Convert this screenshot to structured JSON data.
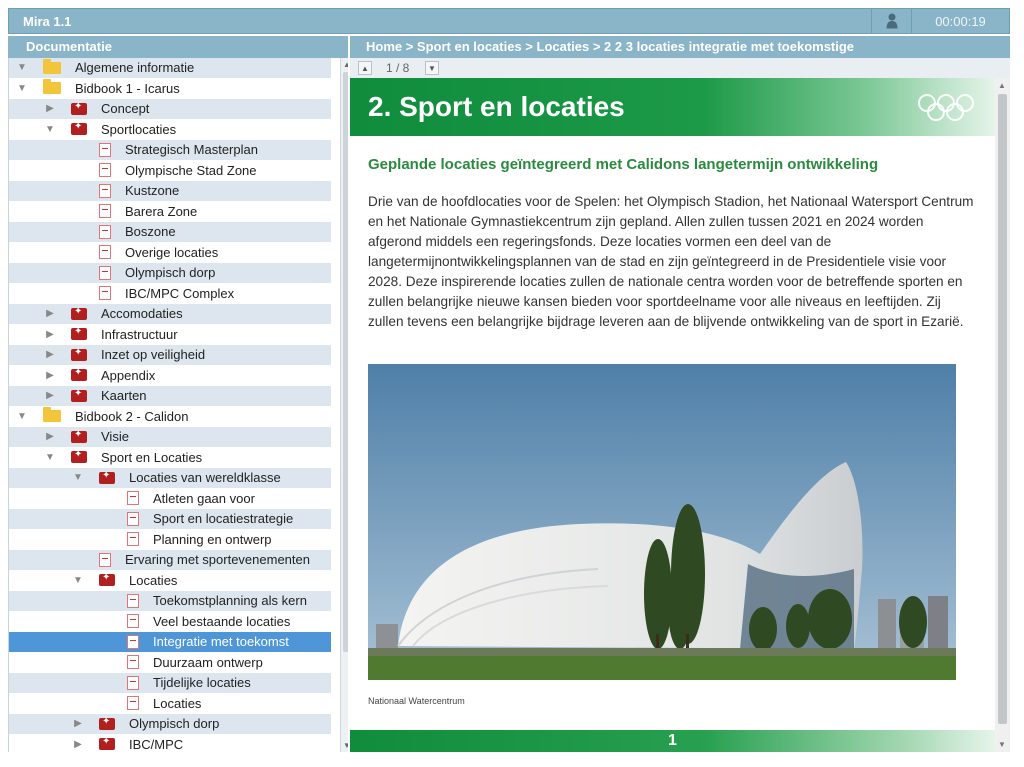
{
  "app": {
    "title": "Mira 1.1",
    "timer": "00:00:19",
    "user_icon": "user-icon"
  },
  "sidebar": {
    "header": "Documentatie",
    "items": [
      {
        "label": "Algemene informatie",
        "level": 0,
        "icon": "folder",
        "expanded": true,
        "shade": true
      },
      {
        "label": "Bidbook 1 - Icarus",
        "level": 0,
        "icon": "folder",
        "expanded": true,
        "shade": false
      },
      {
        "label": "Concept",
        "level": 1,
        "icon": "pdf",
        "expanded": false,
        "shade": true
      },
      {
        "label": "Sportlocaties",
        "level": 1,
        "icon": "pdf",
        "expanded": true,
        "shade": false
      },
      {
        "label": "Strategisch Masterplan",
        "level": 2,
        "icon": "page",
        "shade": true
      },
      {
        "label": "Olympische Stad Zone",
        "level": 2,
        "icon": "page",
        "shade": false
      },
      {
        "label": "Kustzone",
        "level": 2,
        "icon": "page",
        "shade": true
      },
      {
        "label": "Barera Zone",
        "level": 2,
        "icon": "page",
        "shade": false
      },
      {
        "label": "Boszone",
        "level": 2,
        "icon": "page",
        "shade": true
      },
      {
        "label": "Overige locaties",
        "level": 2,
        "icon": "page",
        "shade": false
      },
      {
        "label": "Olympisch dorp",
        "level": 2,
        "icon": "page",
        "shade": true
      },
      {
        "label": "IBC/MPC Complex",
        "level": 2,
        "icon": "page",
        "shade": false
      },
      {
        "label": "Accomodaties",
        "level": 1,
        "icon": "pdf",
        "expanded": false,
        "shade": true
      },
      {
        "label": "Infrastructuur",
        "level": 1,
        "icon": "pdf",
        "expanded": false,
        "shade": false
      },
      {
        "label": "Inzet op veiligheid",
        "level": 1,
        "icon": "pdf",
        "expanded": false,
        "shade": true
      },
      {
        "label": "Appendix",
        "level": 1,
        "icon": "pdf",
        "expanded": false,
        "shade": false
      },
      {
        "label": "Kaarten",
        "level": 1,
        "icon": "pdf",
        "expanded": false,
        "shade": true
      },
      {
        "label": "Bidbook 2 - Calidon",
        "level": 0,
        "icon": "folder",
        "expanded": true,
        "shade": false
      },
      {
        "label": "Visie",
        "level": 1,
        "icon": "pdf",
        "expanded": false,
        "shade": true
      },
      {
        "label": "Sport en Locaties",
        "level": 1,
        "icon": "pdf",
        "expanded": true,
        "shade": false
      },
      {
        "label": "Locaties van wereldklasse",
        "level": 2,
        "icon": "pdf",
        "expanded": true,
        "shade": true
      },
      {
        "label": "Atleten gaan voor",
        "level": 3,
        "icon": "page",
        "shade": false
      },
      {
        "label": "Sport en locatiestrategie",
        "level": 3,
        "icon": "page",
        "shade": true
      },
      {
        "label": "Planning en ontwerp",
        "level": 3,
        "icon": "page",
        "shade": false
      },
      {
        "label": "Ervaring met sportevenementen",
        "level": 2,
        "icon": "page",
        "shade": true
      },
      {
        "label": "Locaties",
        "level": 2,
        "icon": "pdf",
        "expanded": true,
        "shade": false
      },
      {
        "label": "Toekomstplanning als kern",
        "level": 3,
        "icon": "page",
        "shade": true
      },
      {
        "label": "Veel bestaande locaties",
        "level": 3,
        "icon": "page",
        "shade": false
      },
      {
        "label": "Integratie met toekomst",
        "level": 3,
        "icon": "page",
        "shade": false,
        "selected": true
      },
      {
        "label": "Duurzaam ontwerp",
        "level": 3,
        "icon": "page",
        "shade": false
      },
      {
        "label": "Tijdelijke locaties",
        "level": 3,
        "icon": "page",
        "shade": true
      },
      {
        "label": "Locaties",
        "level": 3,
        "icon": "page",
        "shade": false
      },
      {
        "label": "Olympisch dorp",
        "level": 2,
        "icon": "pdf",
        "expanded": false,
        "shade": true
      },
      {
        "label": "IBC/MPC",
        "level": 2,
        "icon": "pdf",
        "expanded": false,
        "shade": false
      }
    ]
  },
  "breadcrumb": "Home > Sport en locaties > Locaties > 2 2 3 locaties integratie met toekomstige",
  "pager": {
    "indicator": "1 / 8",
    "prev_icon": "arrow-up-icon",
    "next_icon": "arrow-down-icon"
  },
  "page": {
    "section_title": "2. Sport en locaties",
    "subtitle": "Geplande locaties geïntegreerd met Calidons langetermijn ontwikkeling",
    "body": "Drie van de hoofdlocaties voor de Spelen: het Olympisch Stadion, het Nationaal Watersport Centrum en het Nationale Gymnastiekcentrum zijn gepland. Allen zullen tussen 2021 en 2024 worden afgerond middels een regeringsfonds. Deze locaties vormen een deel van de langetermijnontwikkelingsplannen van de stad en zijn geïntegreerd in de Presidentiele visie voor 2028. Deze inspirerende locaties zullen de nationale centra worden voor de betreffende sporten en zullen belangrijke nieuwe kansen bieden voor sportdeelname voor alle niveaus en leeftijden. Zij zullen tevens een belangrijke bijdrage leveren aan de blijvende ontwikkeling van de sport in Ezarië.",
    "photo_caption": "Nationaal Watercentrum",
    "page_number": "1"
  },
  "colors": {
    "chrome": "#8ab4c8",
    "accent_green": "#0f8c3c",
    "selected_row": "#4f96d8",
    "row_shade": "#dde6ee"
  }
}
